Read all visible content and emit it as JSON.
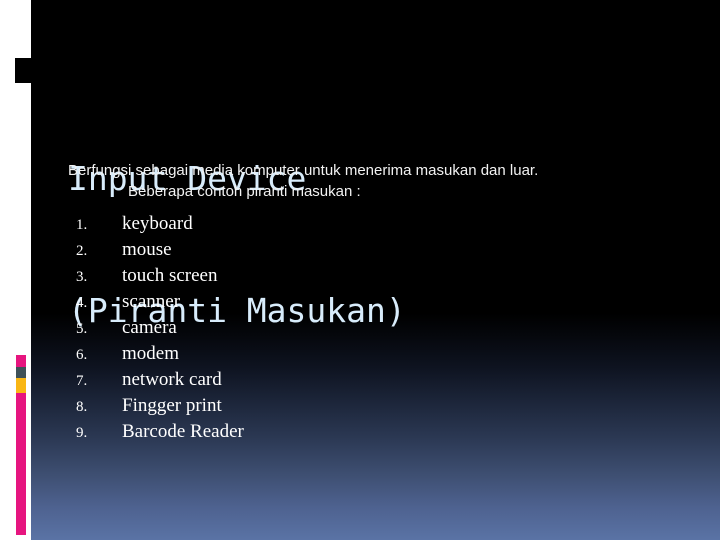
{
  "slide": {
    "title_lines": [
      "Input Device",
      "(Piranti Masukan)"
    ],
    "body_line_1": "Berfungsi sebagai media komputer untuk menerima masukan dan luar.",
    "body_line_2": "Beberapa contoh piranti masukan :",
    "list_items": [
      {
        "number": "1.",
        "label": "keyboard"
      },
      {
        "number": "2.",
        "label": "mouse"
      },
      {
        "number": "3.",
        "label": "touch screen"
      },
      {
        "number": "4.",
        "label": "scanner"
      },
      {
        "number": "5.",
        "label": "camera"
      },
      {
        "number": "6.",
        "label": "modem"
      },
      {
        "number": "7.",
        "label": "network card"
      },
      {
        "number": "8.",
        "label": "Fingger print"
      },
      {
        "number": "9.",
        "label": "Barcode Reader"
      }
    ]
  },
  "colors": {
    "title_text": "#d8ecfb",
    "body_text": "#f2f2f2",
    "list_text": "#ffffff",
    "background_top": "#000000",
    "background_bottom": "#5a73a5",
    "gutter": "#ffffff",
    "accent_pink": "#e6157f",
    "accent_slate": "#3f5158",
    "accent_amber": "#f9b614",
    "deco_tab": "#000000"
  }
}
